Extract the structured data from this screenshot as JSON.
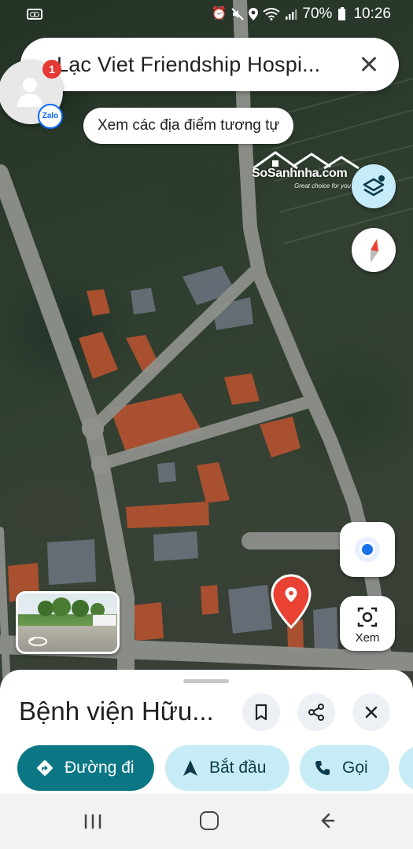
{
  "status_bar": {
    "battery": "70%",
    "time": "10:26"
  },
  "search": {
    "query": "Lạc Viet Friendship Hospi..."
  },
  "zalo": {
    "badge_count": "1",
    "app_label": "Zalo"
  },
  "chip": {
    "label": "Xem các địa điểm tương tự"
  },
  "watermark": {
    "name": "SoSanhnha.com",
    "tagline": "Great choice for you"
  },
  "controls": {
    "lens_label": "Xem"
  },
  "place": {
    "title": "Bệnh viện Hữu..."
  },
  "actions": {
    "directions": "Đường đi",
    "start": "Bắt đầu",
    "call": "Gọi"
  },
  "colors": {
    "primary_teal": "#0b7785",
    "tonal_blue": "#c7ecf6",
    "pin_red": "#e94235",
    "location_blue": "#1a73e8"
  }
}
